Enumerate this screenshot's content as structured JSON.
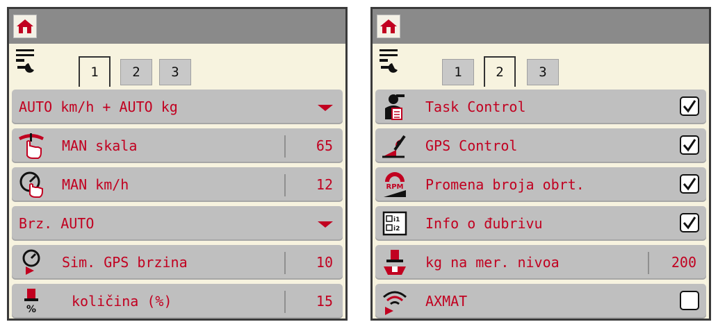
{
  "left_screen": {
    "tabs": [
      {
        "label": "1",
        "active": true
      },
      {
        "label": "2",
        "active": false
      },
      {
        "label": "3",
        "active": false
      }
    ],
    "rows": [
      {
        "label": "AUTO km/h + AUTO kg",
        "type": "dropdown"
      },
      {
        "label": "MAN skala",
        "value": "65",
        "icon": "hand-scale-icon"
      },
      {
        "label": "MAN km/h",
        "value": "12",
        "icon": "hand-speedometer-icon"
      },
      {
        "label": "Brz. AUTO",
        "type": "dropdown"
      },
      {
        "label": "Sim. GPS brzina",
        "value": "10",
        "icon": "gps-speed-icon"
      },
      {
        "label": "količina (%)",
        "value": "15",
        "icon": "quantity-percent-icon"
      }
    ]
  },
  "right_screen": {
    "tabs": [
      {
        "label": "1",
        "active": false
      },
      {
        "label": "2",
        "active": true
      },
      {
        "label": "3",
        "active": false
      }
    ],
    "rows": [
      {
        "label": "Task Control",
        "checked": true,
        "icon": "task-control-icon"
      },
      {
        "label": "GPS Control",
        "checked": true,
        "icon": "gps-control-icon"
      },
      {
        "label": "Promena broja obrt.",
        "checked": true,
        "icon": "rpm-icon"
      },
      {
        "label": "Info o đubrivu",
        "checked": true,
        "icon": "fertilizer-info-icon"
      },
      {
        "label": "kg na mer. nivoa",
        "value": "200",
        "icon": "level-weight-icon"
      },
      {
        "label": "AXMAT",
        "checked": false,
        "icon": "axmat-icon"
      }
    ],
    "rpm_icon_text": "RPM",
    "info_icon_text": [
      "i1",
      "i2"
    ]
  },
  "colors": {
    "accent": "#c10020",
    "title_bar": "#8a8a8a",
    "row_bg": "#bfbfbf",
    "panel_bg": "#f7f3df"
  }
}
